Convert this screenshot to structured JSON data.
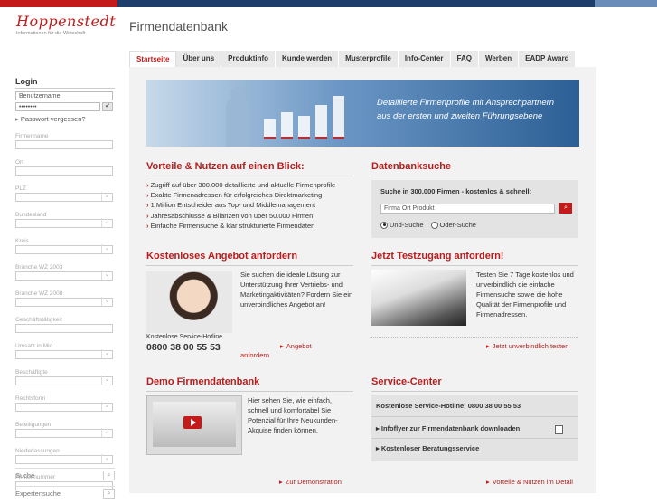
{
  "header": {
    "brand": "Hoppenstedt",
    "tagline": "Informationen für die Wirtschaft",
    "app_title": "Firmendatenbank"
  },
  "tabs": [
    "Startseite",
    "Über uns",
    "Produktinfo",
    "Kunde werden",
    "Musterprofile",
    "Info-Center",
    "FAQ",
    "Werben",
    "EADP Award"
  ],
  "login": {
    "title": "Login",
    "username_placeholder": "Benutzername",
    "password_value": "••••••••",
    "submit_icon": "check-icon",
    "forgot": "Passwort vergessen?"
  },
  "search_fields": [
    "Firmenname",
    "Ort",
    "PLZ",
    "Bundesland",
    "Kreis",
    "Branche WZ 2003",
    "Branche WZ 2008",
    "Geschäftstätigkeit",
    "Umsatz in Mio",
    "Beschäftigte",
    "Rechtsform",
    "Beteiligungen",
    "Niederlassungen",
    "Firmennummer"
  ],
  "bottom_nav": {
    "suche": "Suche",
    "expertensuche": "Expertensuche"
  },
  "banner": {
    "line1": "Detaillierte Firmenprofile mit Ansprechpartnern",
    "line2": "aus der ersten und zweiten Führungsebene"
  },
  "vorteile": {
    "title": "Vorteile & Nutzen auf einen Blick:",
    "items": [
      "Zugriff auf über 300.000 detaillierte und aktuelle Firmenprofile",
      "Exakte Firmenadressen für erfolgreiches Direktmarketing",
      "1 Million Entscheider aus Top- und Middlemanagement",
      "Jahresabschlüsse & Bilanzen von über 50.000 Firmen",
      "Einfache Firmensuche & klar strukturierte Firmendaten"
    ]
  },
  "datenbank": {
    "title": "Datenbanksuche",
    "subtitle": "Suche in 300.000 Firmen - kostenlos & schnell:",
    "input_value": "Firma Ort Produkt",
    "option_und": "Und-Suche",
    "option_oder": "Oder-Suche",
    "selected": "Und-Suche"
  },
  "angebot": {
    "title": "Kostenloses Angebot anfordern",
    "text": "Sie suchen die ideale Lösung zur Unterstützung Ihrer Vertriebs- und Marketingaktivitäten? Fordern Sie ein unverbindliches Angebot an!",
    "hotline_label": "Kostenlose Service-Hotline",
    "hotline_number": "0800 38 00 55 53",
    "link": "Angebot anfordern"
  },
  "testzugang": {
    "title": "Jetzt Testzugang anfordern!",
    "text": "Testen Sie 7 Tage kostenlos und unverbindlich die einfache Firmensuche sowie die hohe Qualität der Firmenprofile und Firmenadressen.",
    "link": "Jetzt unverbindlich testen"
  },
  "demo": {
    "title": "Demo Firmendatenbank",
    "text": "Hier sehen Sie, wie einfach, schnell und komfortabel Sie Potenzial für Ihre Neukunden-Akquise finden können.",
    "link": "Zur Demonstration"
  },
  "service": {
    "title": "Service-Center",
    "hotline": "Kostenlose Service-Hotline: 0800 38 00 55 53",
    "item1": "Infoflyer zur Firmendatenbank downloaden",
    "item2": "Kostenloser Beratungsservice",
    "link": "Vorteile & Nutzen im Detail"
  }
}
